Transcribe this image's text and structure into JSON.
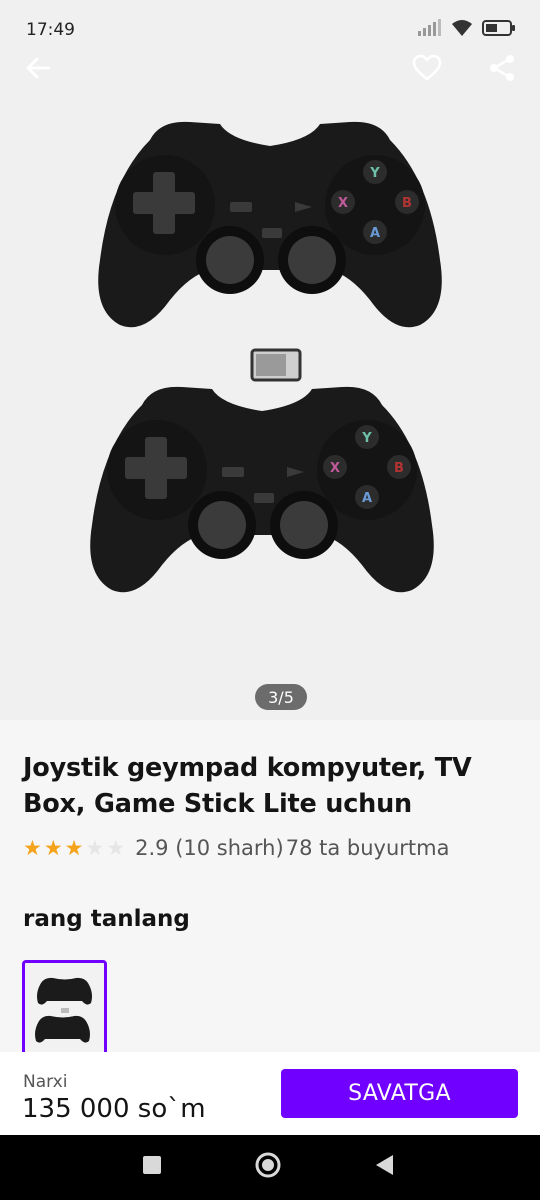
{
  "status_bar": {
    "time": "17:49"
  },
  "icons": {
    "back": "arrow-left-icon",
    "favorite": "heart-icon",
    "share": "share-icon",
    "signal": "signal-icon",
    "wifi": "wifi-icon",
    "battery": "battery-icon"
  },
  "gallery": {
    "counter": "3/5"
  },
  "product": {
    "title": "Joystik geympad kompyuter, TV Box, Game Stick Lite uchun",
    "rating_stars": 3,
    "rating_max": 5,
    "rating_text": "2.9 (10 sharh)",
    "orders_text": "78 ta buyurtma",
    "color_label": "rang tanlang"
  },
  "purchase": {
    "price_label": "Narxi",
    "price_value": "135 000 so`m",
    "cart_button": "SAVATGA"
  },
  "colors": {
    "accent": "#7000ff",
    "star": "#f5a31a"
  }
}
